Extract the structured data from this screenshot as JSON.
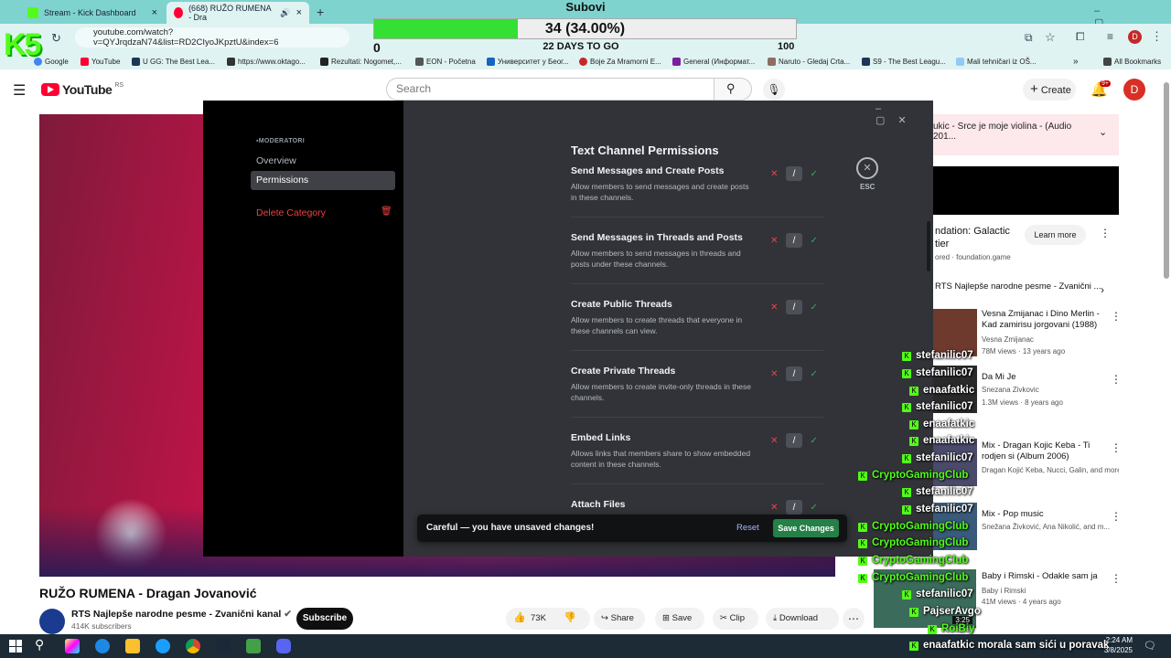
{
  "browser": {
    "tabs": [
      {
        "label": "Stream - Kick Dashboard",
        "close": "×"
      },
      {
        "label": "(668) RUŽO RUMENA - Dra",
        "close": "×"
      }
    ],
    "new_tab": "+",
    "url": "youtube.com/watch?v=QYJrqdzaN74&list=RD2CIyoJKpztU&index=6",
    "bookmarks": [
      "Google",
      "YouTube",
      "U GG: The Best Lea...",
      "https://www.oktago...",
      "Rezultati: Nogomet,...",
      "EON - Početna",
      "Университет у Беог...",
      "Boje Za Mramorni E...",
      "General (Информат...",
      "Naruto - Gledaj Crta...",
      "S9 - The Best Leagu...",
      "Mali tehničari iz OŠ..."
    ],
    "all_bookmarks": "All Bookmarks",
    "profile_initial": "D"
  },
  "goal_overlay": {
    "title": "Subovi",
    "progress_text": "34 (34.00%)",
    "progress_fraction": 0.34,
    "min": "0",
    "days": "22 DAYS TO GO",
    "max": "100",
    "fill_color": "#33e033",
    "logo": "K5"
  },
  "youtube": {
    "logo": "YouTube",
    "region": "RS",
    "search_placeholder": "Search",
    "create_label": "Create",
    "notif_count": "9+",
    "avatar": "D",
    "video_title": "RUŽO RUMENA - Dragan Jovanović",
    "channel": "RTS Najlepše narodne pesme - Zvanični kanal",
    "subscribers": "414K subscribers",
    "subscribe": "Subscribe",
    "likes": "73K",
    "share": "Share",
    "save": "Save",
    "clip": "Clip",
    "download": "Download",
    "mix_title": "ukic - Srce je moje violina - (Audio 201...",
    "ad_title_1": "ndation: Galactic",
    "ad_title_2": "tier",
    "ad_sponsor": "ored · foundation.game",
    "ad_button": "Learn more",
    "playlist_label": "RTS Najlepše narodne pesme - Zvanični ...",
    "recommendations": [
      {
        "title": "Vesna Zmijanac i Dino Merlin - Kad zamirisu jorgovani (1988)",
        "meta": "Vesna Zmijanac",
        "views": "78M views · 13 years ago"
      },
      {
        "title": "Da Mi Je",
        "meta": "Snezana Zivkovic",
        "views": "1.3M views · 8 years ago"
      },
      {
        "title": "Mix - Dragan Kojic Keba - Ti rodjen si (Album 2006)",
        "meta": "Dragan Kojić Keba, Nucci, Galin, and more",
        "views": ""
      },
      {
        "title": "Mix - Pop music",
        "meta": "Snežana Živković, Ana Nikolić, and m...",
        "views": ""
      },
      {
        "title": "Baby i Rimski - Odakle sam ja",
        "meta": "Baby i Rimski",
        "views": "41M views · 4 years ago"
      }
    ],
    "thumb_time": "3:25"
  },
  "discord": {
    "category_label": "MODERATORI",
    "nav": [
      "Overview",
      "Permissions"
    ],
    "delete": "Delete Category",
    "section_title": "Text Channel Permissions",
    "esc": "ESC",
    "permissions": [
      {
        "title": "Send Messages and Create Posts",
        "desc": "Allow members to send messages and create posts in these channels."
      },
      {
        "title": "Send Messages in Threads and Posts",
        "desc": "Allow members to send messages in threads and posts under these channels."
      },
      {
        "title": "Create Public Threads",
        "desc": "Allow members to create threads that everyone in these channels can view."
      },
      {
        "title": "Create Private Threads",
        "desc": "Allow members to create invite-only threads in these channels."
      },
      {
        "title": "Embed Links",
        "desc": "Allows links that members share to show embedded content in these channels."
      },
      {
        "title": "Attach Files",
        "desc": ""
      }
    ],
    "tri_symbols": [
      "✕",
      "/",
      "✓"
    ],
    "unsaved_text": "Careful — you have unsaved changes!",
    "reset": "Reset",
    "save_changes": "Save Changes"
  },
  "chat": [
    {
      "user": "stefanilic07",
      "msg": "",
      "color": "#ffffff"
    },
    {
      "user": "stefanilic07",
      "msg": "",
      "color": "#ffffff"
    },
    {
      "user": "enaafatkic",
      "msg": "",
      "color": "#ffffff"
    },
    {
      "user": "stefanilic07",
      "msg": "",
      "color": "#ffffff"
    },
    {
      "user": "enaafatkic",
      "msg": "",
      "color": "#ffffff"
    },
    {
      "user": "enaafatkic",
      "msg": "",
      "color": "#ffffff"
    },
    {
      "user": "stefanilic07",
      "msg": "",
      "color": "#ffffff"
    },
    {
      "user": "CryptoGamingClub",
      "msg": "",
      "color": "#53fc18"
    },
    {
      "user": "stefanilic07",
      "msg": "",
      "color": "#ffffff"
    },
    {
      "user": "stefanilic07",
      "msg": "",
      "color": "#ffffff"
    },
    {
      "user": "CryptoGamingClub",
      "msg": "",
      "color": "#53fc18"
    },
    {
      "user": "CryptoGamingClub",
      "msg": "",
      "color": "#53fc18"
    },
    {
      "user": "CryptoGamingClub",
      "msg": "",
      "color": "#53fc18"
    },
    {
      "user": "CryptoGamingClub",
      "msg": "",
      "color": "#53fc18"
    },
    {
      "user": "stefanilic07",
      "msg": "",
      "color": "#ffffff"
    },
    {
      "user": "PajserAvgo",
      "msg": "",
      "color": "#ffffff"
    },
    {
      "user": "RoiBiy",
      "msg": "",
      "color": "#53fc18"
    },
    {
      "user": "enaafatkic",
      "msg": "morala sam sići u poravak",
      "color": "#ffffff"
    }
  ],
  "taskbar": {
    "time": "2:24 AM",
    "date": "3/8/2025"
  },
  "colors": {
    "discord_bg": "#313338",
    "discord_green": "#248046",
    "discord_red": "#ed4245",
    "kick_green": "#53fc18",
    "browser_frame": "#7fd3cf"
  }
}
